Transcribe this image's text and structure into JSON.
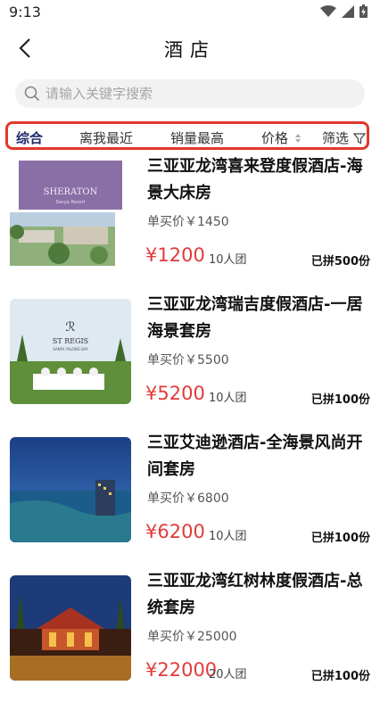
{
  "status": {
    "time": "9:13"
  },
  "header": {
    "title": "酒店"
  },
  "search": {
    "placeholder": "请输入关键字搜索"
  },
  "filters": [
    "综合",
    "离我最近",
    "销量最高",
    "价格",
    "筛选"
  ],
  "hotels": [
    {
      "name": "三亚亚龙湾喜来登度假酒店-海景大床房",
      "solo_price": "单买价￥1450",
      "group_price": "¥1200",
      "group_size": "10人团",
      "sold": "已拼500份",
      "image_text": "SHERATON",
      "image_subtext": "Sanya Resort"
    },
    {
      "name": "三亚亚龙湾瑞吉度假酒店-一居海景套房",
      "solo_price": "单买价￥5500",
      "group_price": "¥5200",
      "group_size": "10人团",
      "sold": "已拼100份",
      "image_text": "ST REGIS",
      "image_subtext": "SANYA YALONG BAY"
    },
    {
      "name": "三亚艾迪逊酒店-全海景风尚开间套房",
      "solo_price": "单买价￥6800",
      "group_price": "¥6200",
      "group_size": "10人团",
      "sold": "已拼100份"
    },
    {
      "name": "三亚亚龙湾红树林度假酒店-总统套房",
      "solo_price": "单买价￥25000",
      "group_price": "¥22000",
      "group_size": "20人团",
      "sold": "已拼100份"
    }
  ]
}
